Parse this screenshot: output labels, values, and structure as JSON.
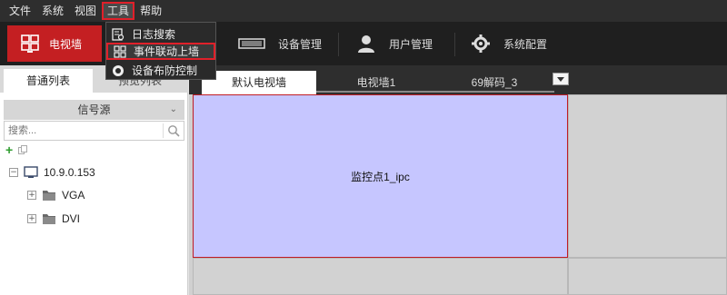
{
  "menubar": {
    "items": [
      "文件",
      "系统",
      "视图",
      "工具",
      "帮助"
    ],
    "active": "工具"
  },
  "toolbar": {
    "items": [
      {
        "label": "电视墙",
        "icon": "tv-wall-icon",
        "active": true
      },
      {
        "label": "设备管理",
        "icon": "device-icon"
      },
      {
        "label": "用户管理",
        "icon": "user-icon"
      },
      {
        "label": "系统配置",
        "icon": "gear-icon"
      }
    ]
  },
  "tools_menu": {
    "items": [
      {
        "label": "日志搜索",
        "icon": "log-search-icon"
      },
      {
        "label": "事件联动上墙",
        "icon": "event-linkage-icon",
        "highlighted": true
      },
      {
        "label": "设备布防控制",
        "icon": "arm-control-icon"
      }
    ]
  },
  "left_panel": {
    "tabs": [
      "普通列表",
      "预览列表"
    ],
    "active_tab": "普通列表",
    "section_title": "信号源",
    "search_placeholder": "搜索...",
    "tree": {
      "device": "10.9.0.153",
      "children": [
        "VGA",
        "DVI"
      ]
    }
  },
  "wall": {
    "tabs": [
      "默认电视墙",
      "电视墙1",
      "69解码_3"
    ],
    "active_tab": "默认电视墙",
    "selected_cell_label": "监控点1_ipc"
  },
  "colors": {
    "accent_red": "#c41f22",
    "highlight_border": "#e0202a",
    "selected_cell": "#c6c6ff",
    "toolbar_bg": "#1f1f1f"
  }
}
